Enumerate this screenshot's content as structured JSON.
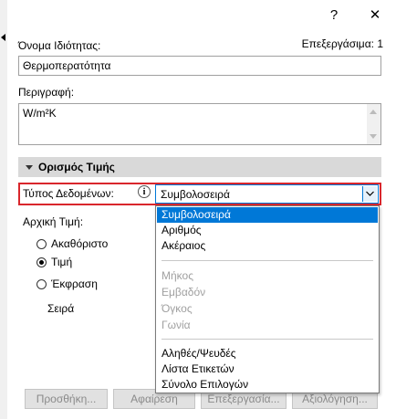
{
  "titlebar": {
    "help_label": "?",
    "close_label": "✕"
  },
  "edit_info": "Επεξεργάσιμα: 1",
  "property_name": {
    "label": "Όνομα Ιδιότητας:",
    "value": "Θερμοπερατότητα"
  },
  "description": {
    "label": "Περιγραφή:",
    "value": "W/m²K"
  },
  "section": {
    "title": "Ορισμός Τιμής"
  },
  "data_type": {
    "label": "Τύπος Δεδομένων:",
    "info_glyph": "i",
    "selected": "Συμβολοσειρά",
    "options_group1": [
      "Συμβολοσειρά",
      "Αριθμός",
      "Ακέραιος"
    ],
    "options_group2": [
      "Μήκος",
      "Εμβαδόν",
      "Όγκος",
      "Γωνία"
    ],
    "options_group3": [
      "Αληθές/Ψευδές",
      "Λίστα Ετικετών",
      "Σύνολο Επιλογών"
    ]
  },
  "initial_value": {
    "label": "Αρχική Τιμή:",
    "options": [
      "Ακαθόριστο",
      "Τιμή",
      "Έκφραση"
    ],
    "selected": "Τιμή"
  },
  "list_header": "Σειρά",
  "buttons": {
    "add": "Προσθήκη...",
    "remove": "Αφαίρεση",
    "edit": "Επεξεργασία...",
    "evaluate": "Αξιολόγηση..."
  },
  "colors": {
    "highlight": "#d9262c",
    "selection": "#0078d7",
    "section_bg": "#d9d9d9"
  }
}
